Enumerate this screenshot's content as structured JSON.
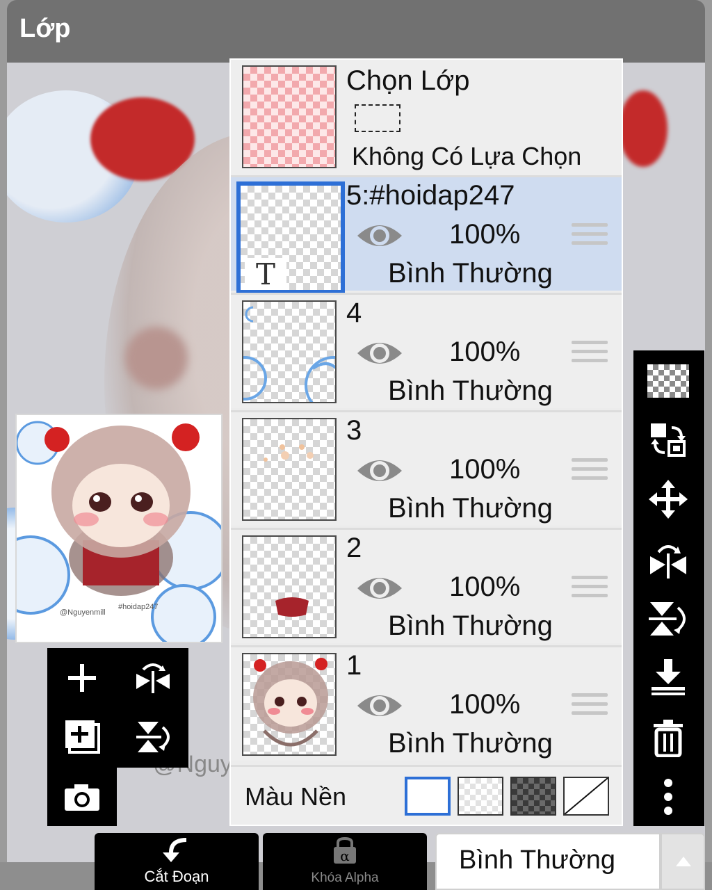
{
  "header": {
    "title": "Lớp"
  },
  "selection": {
    "title": "Chọn Lớp",
    "status": "Không Có Lựa Chọn"
  },
  "layers": [
    {
      "name": "5:#hoidap247",
      "opacity": "100%",
      "blend": "Bình Thường",
      "active": true,
      "thumb_icon": "T"
    },
    {
      "name": "4",
      "opacity": "100%",
      "blend": "Bình Thường",
      "active": false
    },
    {
      "name": "3",
      "opacity": "100%",
      "blend": "Bình Thường",
      "active": false
    },
    {
      "name": "2",
      "opacity": "100%",
      "blend": "Bình Thường",
      "active": false
    },
    {
      "name": "1",
      "opacity": "100%",
      "blend": "Bình Thường",
      "active": false
    }
  ],
  "background": {
    "label": "Màu Nền",
    "options": [
      "white",
      "transparent-light",
      "transparent-dark",
      "none"
    ],
    "selected": "white"
  },
  "preview": {
    "watermark_left": "@Nguyenmill",
    "watermark_right": "#hoidap247"
  },
  "canvas_text": "@Nguy",
  "right_toolbar": [
    "checker-icon",
    "swap-layer-icon",
    "move-icon",
    "flip-horizontal-icon",
    "flip-vertical-icon",
    "merge-down-icon",
    "trash-icon",
    "more-icon"
  ],
  "mini_toolbar": [
    "add-layer-icon",
    "flip-horizontal-icon",
    "duplicate-layer-icon",
    "flip-vertical-icon",
    "camera-icon"
  ],
  "bottom": {
    "clip_label": "Cắt Đoạn",
    "alpha_label": "Khóa Alpha",
    "blend_mode": "Bình Thường"
  },
  "colors": {
    "accent": "#2d6fd6",
    "active_row": "#cfdcf0",
    "toolbar": "#000000",
    "title_bar": "#717171"
  }
}
